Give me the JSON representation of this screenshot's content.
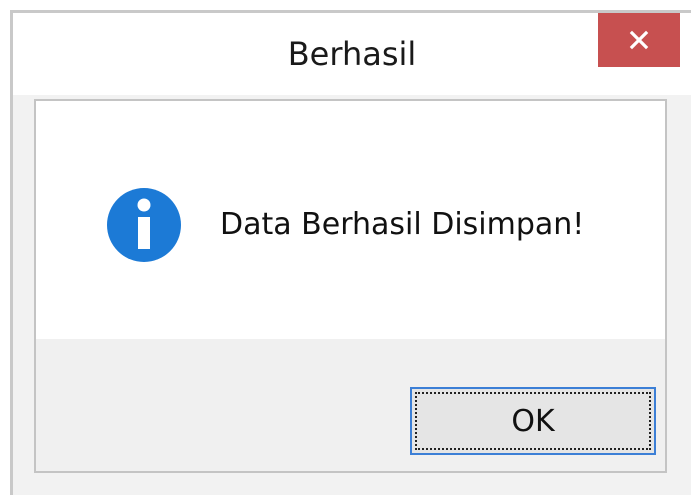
{
  "dialog": {
    "title": "Berhasil",
    "close_label": "×",
    "message": "Data Berhasil Disimpan!",
    "icon": "info-icon",
    "ok_label": "OK"
  },
  "colors": {
    "close_button_bg": "#c75050",
    "info_icon": "#1c7ad6",
    "focus_border": "#3c7fd6"
  }
}
